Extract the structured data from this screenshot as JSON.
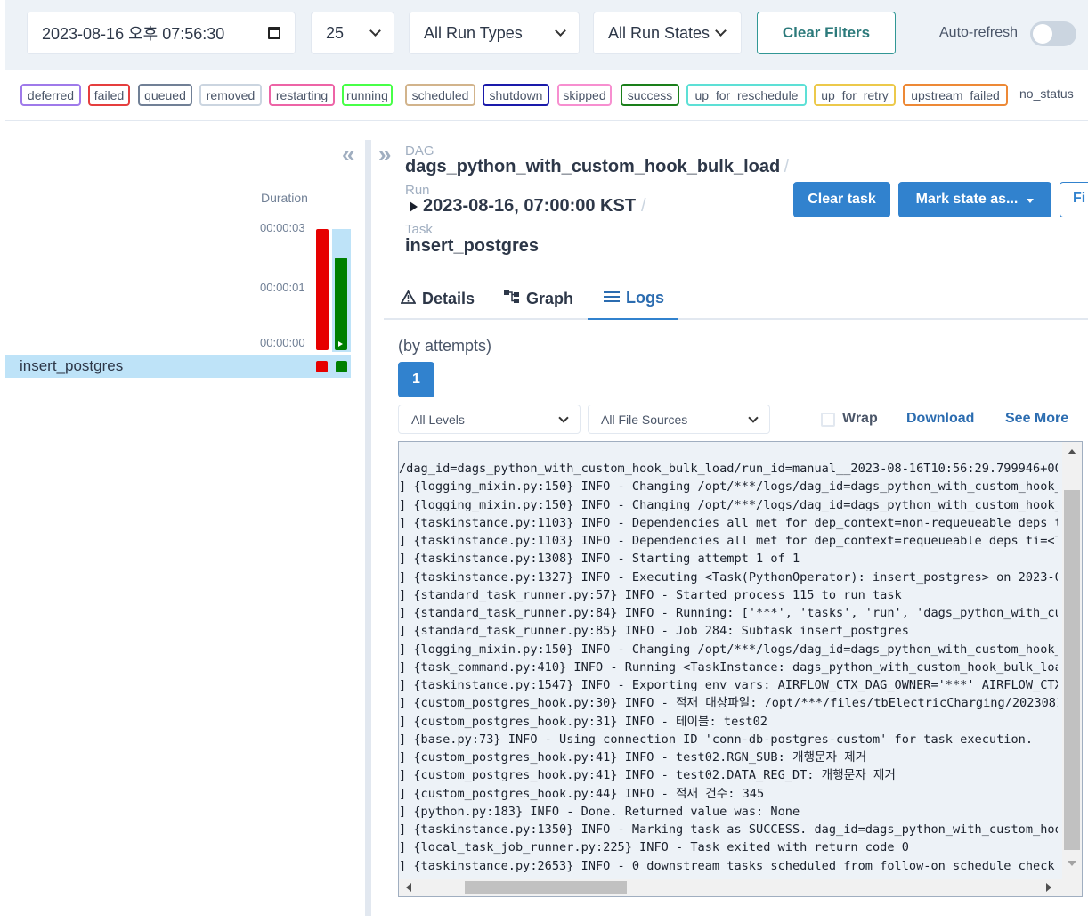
{
  "filters": {
    "datetime": "2023-08-16 오후 07:56:30",
    "page_size": "25",
    "run_types": "All Run Types",
    "run_states": "All Run States",
    "clear_filters_label": "Clear Filters",
    "auto_refresh_label": "Auto-refresh",
    "auto_refresh_on": false
  },
  "legend": [
    {
      "label": "deferred",
      "color": "#9f7aea"
    },
    {
      "label": "failed",
      "color": "#e53e3e"
    },
    {
      "label": "queued",
      "color": "#718096"
    },
    {
      "label": "removed",
      "color": "#cbd5e0"
    },
    {
      "label": "restarting",
      "color": "#ed64a6"
    },
    {
      "label": "running",
      "color": "#48ff48"
    },
    {
      "label": "scheduled",
      "color": "#d2b48c"
    },
    {
      "label": "shutdown",
      "color": "#1a1aaa"
    },
    {
      "label": "skipped",
      "color": "#f78fd0"
    },
    {
      "label": "success",
      "color": "#1a7f1a"
    },
    {
      "label": "up_for_reschedule",
      "color": "#5de0d6"
    },
    {
      "label": "up_for_retry",
      "color": "#ecc94b"
    },
    {
      "label": "upstream_failed",
      "color": "#ed8936"
    },
    {
      "label": "no_status",
      "color": ""
    }
  ],
  "grid": {
    "duration_label": "Duration",
    "ticks": [
      "00:00:03",
      "00:00:01",
      "00:00:00"
    ],
    "task_name": "insert_postgres",
    "runs": [
      {
        "state": "failed",
        "color": "#e60000"
      },
      {
        "state": "success",
        "color": "#008000"
      }
    ]
  },
  "header": {
    "dag_label": "DAG",
    "dag_id": "dags_python_with_custom_hook_bulk_load",
    "run_label": "Run",
    "run_id": "2023-08-16, 07:00:00 KST",
    "task_label": "Task",
    "task_id": "insert_postgres",
    "clear_task_label": "Clear task",
    "mark_state_label": "Mark state as...",
    "filter_label": "Fi"
  },
  "tabs": [
    {
      "label": "Details",
      "icon": "warning-triangle-icon"
    },
    {
      "label": "Graph",
      "icon": "graph-icon"
    },
    {
      "label": "Logs",
      "icon": "list-icon",
      "active": true
    }
  ],
  "logs": {
    "attempts_label": "(by attempts)",
    "attempt": "1",
    "levels": "All Levels",
    "file_sources": "All File Sources",
    "wrap_label": "Wrap",
    "download_label": "Download",
    "see_more_label": "See More",
    "lines": [
      "/dag_id=dags_python_with_custom_hook_bulk_load/run_id=manual__2023-08-16T10:56:29.799946+00:0",
      "] {logging_mixin.py:150} INFO - Changing /opt/***/logs/dag_id=dags_python_with_custom_hook_b",
      "] {logging_mixin.py:150} INFO - Changing /opt/***/logs/dag_id=dags_python_with_custom_hook_b",
      "] {taskinstance.py:1103} INFO - Dependencies all met for dep_context=non-requeueable deps ti",
      "] {taskinstance.py:1103} INFO - Dependencies all met for dep_context=requeueable deps ti=<Ta",
      "] {taskinstance.py:1308} INFO - Starting attempt 1 of 1",
      "] {taskinstance.py:1327} INFO - Executing <Task(PythonOperator): insert_postgres> on 2023-08",
      "] {standard_task_runner.py:57} INFO - Started process 115 to run task",
      "] {standard_task_runner.py:84} INFO - Running: ['***', 'tasks', 'run', 'dags_python_with_cus",
      "] {standard_task_runner.py:85} INFO - Job 284: Subtask insert_postgres",
      "] {logging_mixin.py:150} INFO - Changing /opt/***/logs/dag_id=dags_python_with_custom_hook_b",
      "] {task_command.py:410} INFO - Running <TaskInstance: dags_python_with_custom_hook_bulk_load",
      "] {taskinstance.py:1547} INFO - Exporting env vars: AIRFLOW_CTX_DAG_OWNER='***' AIRFLOW_CTX_D",
      "] {custom_postgres_hook.py:30} INFO - 적재 대상파일: /opt/***/files/tbElectricCharging/20230816",
      "] {custom_postgres_hook.py:31} INFO - 테이블: test02",
      "] {base.py:73} INFO - Using connection ID 'conn-db-postgres-custom' for task execution.",
      "] {custom_postgres_hook.py:41} INFO - test02.RGN_SUB: 개행문자 제거",
      "] {custom_postgres_hook.py:41} INFO - test02.DATA_REG_DT: 개행문자 제거",
      "] {custom_postgres_hook.py:44} INFO - 적재 건수: 345",
      "] {python.py:183} INFO - Done. Returned value was: None",
      "] {taskinstance.py:1350} INFO - Marking task as SUCCESS. dag_id=dags_python_with_custom_hook_",
      "] {local_task_job_runner.py:225} INFO - Task exited with return code 0",
      "] {taskinstance.py:2653} INFO - 0 downstream tasks scheduled from follow-on schedule check"
    ]
  }
}
